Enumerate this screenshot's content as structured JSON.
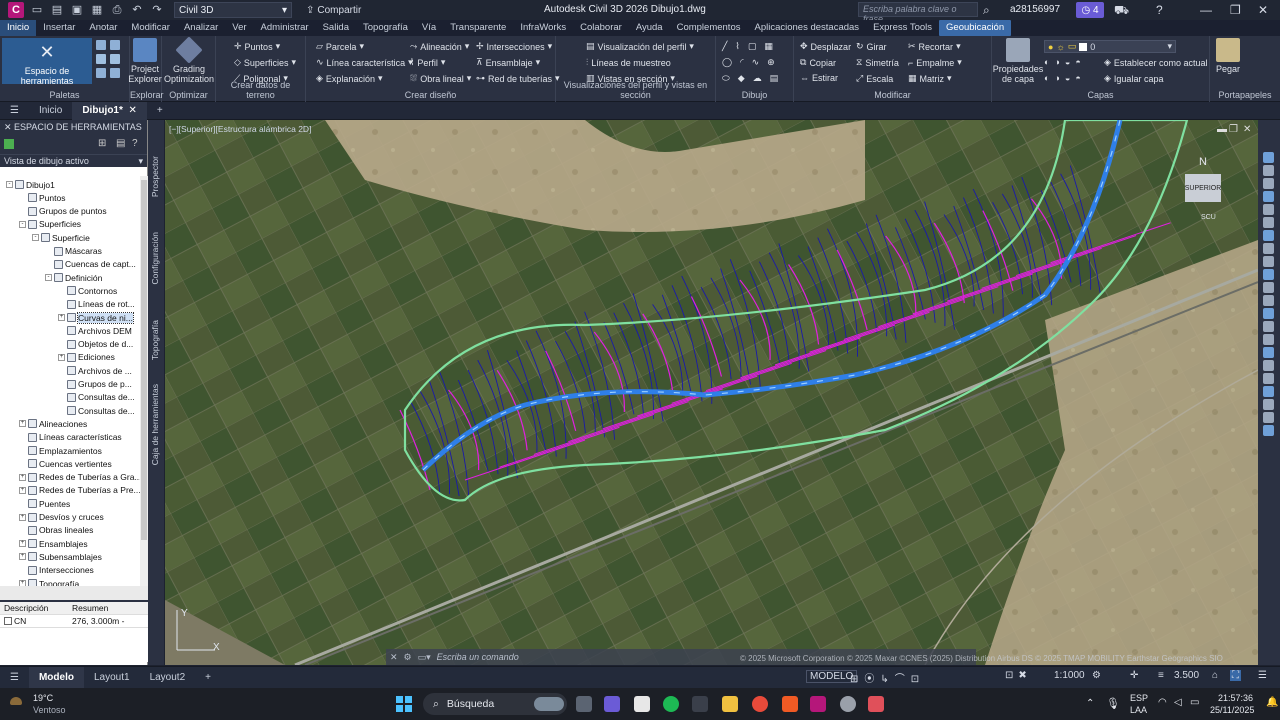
{
  "titlebar": {
    "app_letter": "C",
    "workspace": "Civil 3D",
    "share": "Compartir",
    "title": "Autodesk Civil 3D 2026   Dibujo1.dwg",
    "search_placeholder": "Escriba palabra clave o frase",
    "user": "a28156997",
    "notifications": "4"
  },
  "ribbon_tabs": [
    "Inicio",
    "Insertar",
    "Anotar",
    "Modificar",
    "Analizar",
    "Ver",
    "Administrar",
    "Salida",
    "Topografía",
    "Vía",
    "Transparente",
    "InfraWorks",
    "Colaborar",
    "Ayuda",
    "Complementos",
    "Aplicaciones destacadas",
    "Express Tools",
    "Geoubicación"
  ],
  "ribbon": {
    "palettes": {
      "title": "Paletas",
      "big": "Espacio de herramientas"
    },
    "explorar": {
      "title": "Explorar",
      "big": "Project Explorer"
    },
    "optimizar": {
      "title": "Optimizar",
      "big": "Grading Optimization"
    },
    "terreno": {
      "title": "Crear datos de terreno",
      "items": [
        "Puntos",
        "Superficies",
        "Poligonal"
      ]
    },
    "diseno": {
      "title": "Crear diseño",
      "items": [
        "Parcela",
        "Línea característica",
        "Explanación",
        "Alineación",
        "Perfil",
        "Obra lineal",
        "Intersecciones",
        "Ensamblaje",
        "Red de tuberías"
      ]
    },
    "perfil": {
      "title": "Visualizaciones del perfil y vistas en sección",
      "items": [
        "Visualización del perfil",
        "Líneas de muestreo",
        "Vistas en sección"
      ]
    },
    "dibujo": {
      "title": "Dibujo"
    },
    "modificar": {
      "title": "Modificar",
      "items": [
        "Desplazar",
        "Girar",
        "Recortar",
        "Copiar",
        "Simetría",
        "Empalme",
        "Estirar",
        "Escala",
        "Matriz"
      ]
    },
    "capas": {
      "title": "Capas",
      "big": "Propiedades de capa",
      "layer": "0",
      "items": [
        "Establecer como actual",
        "Igualar capa"
      ]
    },
    "portapapeles": {
      "title": "Portapapeles",
      "big": "Pegar"
    }
  },
  "doc_tabs": [
    "Inicio",
    "Dibujo1*"
  ],
  "toolspace": {
    "header": "ESPACIO DE HERRAMIENTAS",
    "view": "Vista de dibujo activo",
    "side_tabs": [
      "Prospector",
      "Configuración",
      "Topografía",
      "Caja de herramientas"
    ],
    "tree": [
      {
        "label": "Dibujo1",
        "indent": 0,
        "exp": "-"
      },
      {
        "label": "Puntos",
        "indent": 1,
        "exp": ""
      },
      {
        "label": "Grupos de puntos",
        "indent": 1,
        "exp": ""
      },
      {
        "label": "Superficies",
        "indent": 1,
        "exp": "-"
      },
      {
        "label": "Superficie",
        "indent": 2,
        "exp": "-"
      },
      {
        "label": "Máscaras",
        "indent": 3,
        "exp": ""
      },
      {
        "label": "Cuencas de capt...",
        "indent": 3,
        "exp": ""
      },
      {
        "label": "Definición",
        "indent": 3,
        "exp": "-"
      },
      {
        "label": "Contornos",
        "indent": 4,
        "exp": ""
      },
      {
        "label": "Líneas de rot...",
        "indent": 4,
        "exp": ""
      },
      {
        "label": "Curvas de ni...",
        "indent": 4,
        "exp": "+",
        "sel": true
      },
      {
        "label": "Archivos DEM",
        "indent": 4,
        "exp": ""
      },
      {
        "label": "Objetos de d...",
        "indent": 4,
        "exp": ""
      },
      {
        "label": "Ediciones",
        "indent": 4,
        "exp": "+"
      },
      {
        "label": "Archivos de ...",
        "indent": 4,
        "exp": ""
      },
      {
        "label": "Grupos de p...",
        "indent": 4,
        "exp": ""
      },
      {
        "label": "Consultas de...",
        "indent": 4,
        "exp": ""
      },
      {
        "label": "Consultas de...",
        "indent": 4,
        "exp": ""
      },
      {
        "label": "Alineaciones",
        "indent": 1,
        "exp": "+"
      },
      {
        "label": "Líneas características",
        "indent": 1,
        "exp": ""
      },
      {
        "label": "Emplazamientos",
        "indent": 1,
        "exp": ""
      },
      {
        "label": "Cuencas vertientes",
        "indent": 1,
        "exp": ""
      },
      {
        "label": "Redes de Tuberías a Gra...",
        "indent": 1,
        "exp": "+"
      },
      {
        "label": "Redes de Tuberías a Pre...",
        "indent": 1,
        "exp": "+"
      },
      {
        "label": "Puentes",
        "indent": 1,
        "exp": ""
      },
      {
        "label": "Desvíos y cruces",
        "indent": 1,
        "exp": "+"
      },
      {
        "label": "Obras lineales",
        "indent": 1,
        "exp": ""
      },
      {
        "label": "Ensamblajes",
        "indent": 1,
        "exp": "+"
      },
      {
        "label": "Subensamblajes",
        "indent": 1,
        "exp": "+"
      },
      {
        "label": "Intersecciones",
        "indent": 1,
        "exp": ""
      },
      {
        "label": "Topografía",
        "indent": 1,
        "exp": "+"
      }
    ],
    "desc_headers": [
      "Descripción",
      "Resumen"
    ],
    "desc_rows": [
      {
        "name": "CN",
        "summary": "276, 3.000m -"
      }
    ]
  },
  "viewport": {
    "label": "[−][Superior][Estructura alámbrica 2D]",
    "compass_n": "N",
    "compass_center": "SUPERIOR",
    "scu": "SCU",
    "command_placeholder": "Escriba un comando",
    "attribution": "© 2025 Microsoft Corporation © 2025 Maxar ©CNES (2025) Distribution Airbus DS © 2025 TMAP MOBILITY Earthstar Geographics SIO",
    "ucs_x": "X",
    "ucs_y": "Y"
  },
  "statusbar": {
    "tabs": [
      "Modelo",
      "Layout1",
      "Layout2"
    ],
    "model": "MODELO",
    "scale": "1:1000",
    "value": "3.500"
  },
  "taskbar": {
    "temp": "19°C",
    "weather": "Ventoso",
    "search": "Búsqueda",
    "lang1": "ESP",
    "lang2": "LAA",
    "time": "21:57:36",
    "date": "25/11/2025"
  },
  "colors": {
    "accent": "#3a6aa8",
    "boundary": "#7fe0a0",
    "contour_major": "#e020e0",
    "contour_minor": "#1a1aa8",
    "alignment": "#2f7fe8"
  }
}
